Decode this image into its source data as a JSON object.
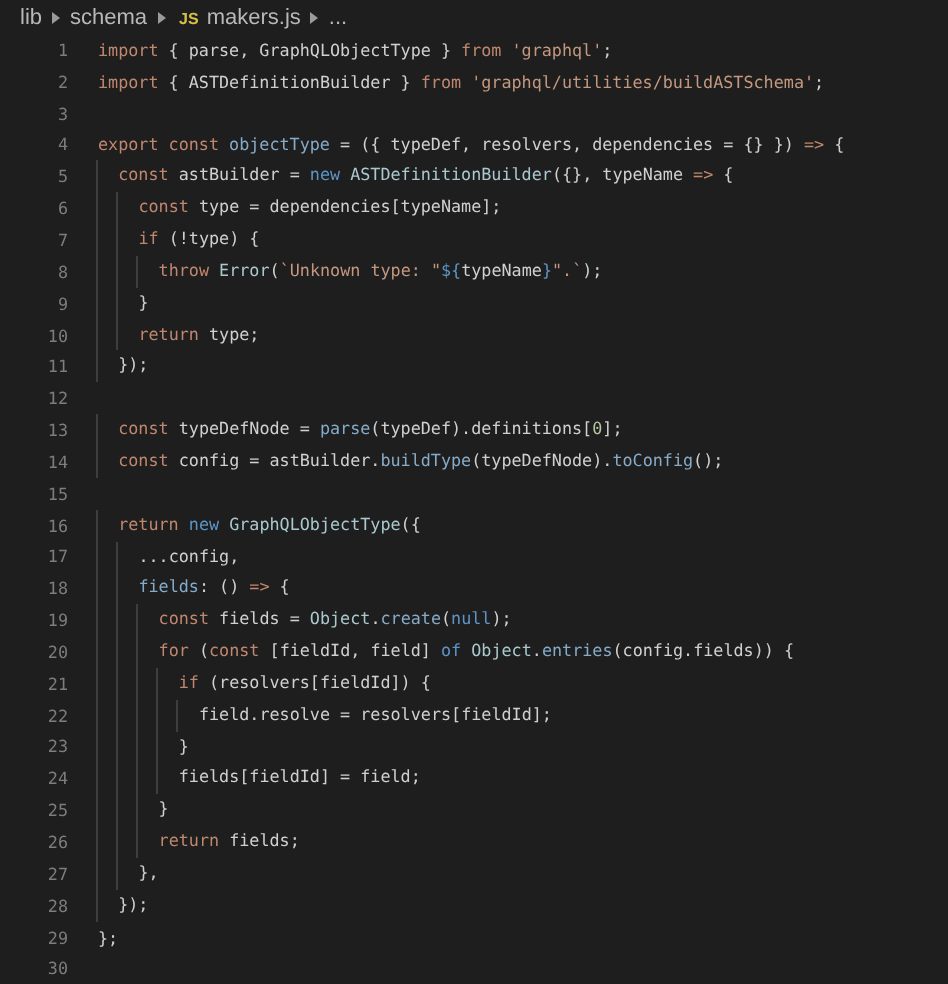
{
  "breadcrumb": [
    {
      "kind": "folder",
      "label": "lib"
    },
    {
      "kind": "folder",
      "label": "schema"
    },
    {
      "kind": "file",
      "badge": "JS",
      "label": "makers.js"
    },
    {
      "kind": "more",
      "label": "..."
    }
  ],
  "lines": [
    {
      "number": "1",
      "tokens": [
        {
          "kind": "kw",
          "text": "import"
        },
        {
          "kind": "plain",
          "text": " { parse, GraphQLObjectType } "
        },
        {
          "kind": "kw",
          "text": "from"
        },
        {
          "kind": "str",
          "text": " 'graphql'"
        },
        {
          "kind": "plain",
          "text": ";"
        }
      ]
    },
    {
      "number": "2",
      "tokens": [
        {
          "kind": "kw",
          "text": "import"
        },
        {
          "kind": "plain",
          "text": " { ASTDefinitionBuilder } "
        },
        {
          "kind": "kw",
          "text": "from"
        },
        {
          "kind": "str",
          "text": " 'graphql/utilities/buildASTSchema'"
        },
        {
          "kind": "plain",
          "text": ";"
        }
      ]
    },
    {
      "number": "3"
    },
    {
      "number": "4",
      "tokens": [
        {
          "kind": "kw",
          "text": "export const"
        },
        {
          "kind": "fn",
          "text": " objectType"
        },
        {
          "kind": "plain",
          "text": " = ({ typeDef, resolvers, dependencies = {} }) "
        },
        {
          "kind": "kw",
          "text": "=>"
        },
        {
          "kind": "plain",
          "text": " {"
        }
      ]
    },
    {
      "number": "5",
      "tokens": [
        {
          "kind": "kw",
          "text": "  const"
        },
        {
          "kind": "plain",
          "text": " astBuilder = "
        },
        {
          "kind": "blue",
          "text": "new"
        },
        {
          "kind": "cls",
          "text": " ASTDefinitionBuilder"
        },
        {
          "kind": "plain",
          "text": "({}, typeName "
        },
        {
          "kind": "kw",
          "text": "=>"
        },
        {
          "kind": "plain",
          "text": " {"
        }
      ]
    },
    {
      "number": "6",
      "tokens": [
        {
          "kind": "kw",
          "text": "    const"
        },
        {
          "kind": "plain",
          "text": " type = dependencies[typeName];"
        }
      ]
    },
    {
      "number": "7",
      "tokens": [
        {
          "kind": "kw",
          "text": "    if"
        },
        {
          "kind": "plain",
          "text": " (!type) {"
        }
      ]
    },
    {
      "number": "8",
      "tokens": [
        {
          "kind": "kw",
          "text": "      throw"
        },
        {
          "kind": "cls",
          "text": " Error"
        },
        {
          "kind": "plain",
          "text": "("
        },
        {
          "kind": "str",
          "text": "`Unknown type: \""
        },
        {
          "kind": "blue",
          "text": "${"
        },
        {
          "kind": "plain",
          "text": "typeName"
        },
        {
          "kind": "blue",
          "text": "}"
        },
        {
          "kind": "str",
          "text": "\".`"
        },
        {
          "kind": "plain",
          "text": ");"
        }
      ]
    },
    {
      "number": "9",
      "tokens": [
        {
          "kind": "plain",
          "text": "    }"
        }
      ]
    },
    {
      "number": "10",
      "tokens": [
        {
          "kind": "kw",
          "text": "    return"
        },
        {
          "kind": "plain",
          "text": " type;"
        }
      ]
    },
    {
      "number": "11",
      "tokens": [
        {
          "kind": "plain",
          "text": "  });"
        }
      ]
    },
    {
      "number": "12"
    },
    {
      "number": "13",
      "tokens": [
        {
          "kind": "kw",
          "text": "  const"
        },
        {
          "kind": "plain",
          "text": " typeDefNode = "
        },
        {
          "kind": "fn",
          "text": "parse"
        },
        {
          "kind": "plain",
          "text": "(typeDef).definitions["
        },
        {
          "kind": "num",
          "text": "0"
        },
        {
          "kind": "plain",
          "text": "];"
        }
      ]
    },
    {
      "number": "14",
      "tokens": [
        {
          "kind": "kw",
          "text": "  const"
        },
        {
          "kind": "plain",
          "text": " config = astBuilder."
        },
        {
          "kind": "fn",
          "text": "buildType"
        },
        {
          "kind": "plain",
          "text": "(typeDefNode)."
        },
        {
          "kind": "fn",
          "text": "toConfig"
        },
        {
          "kind": "plain",
          "text": "();"
        }
      ]
    },
    {
      "number": "15"
    },
    {
      "number": "16",
      "tokens": [
        {
          "kind": "kw",
          "text": "  return"
        },
        {
          "kind": "blue",
          "text": " new"
        },
        {
          "kind": "cls",
          "text": " GraphQLObjectType"
        },
        {
          "kind": "plain",
          "text": "({"
        }
      ]
    },
    {
      "number": "17",
      "tokens": [
        {
          "kind": "plain",
          "text": "    ...config,"
        }
      ]
    },
    {
      "number": "18",
      "tokens": [
        {
          "kind": "fn",
          "text": "    fields"
        },
        {
          "kind": "plain",
          "text": ": () "
        },
        {
          "kind": "kw",
          "text": "=>"
        },
        {
          "kind": "plain",
          "text": " {"
        }
      ]
    },
    {
      "number": "19",
      "tokens": [
        {
          "kind": "kw",
          "text": "      const"
        },
        {
          "kind": "plain",
          "text": " fields = "
        },
        {
          "kind": "cls",
          "text": "Object"
        },
        {
          "kind": "plain",
          "text": "."
        },
        {
          "kind": "fn",
          "text": "create"
        },
        {
          "kind": "plain",
          "text": "("
        },
        {
          "kind": "blue",
          "text": "null"
        },
        {
          "kind": "plain",
          "text": ");"
        }
      ]
    },
    {
      "number": "20",
      "tokens": [
        {
          "kind": "kw",
          "text": "      for"
        },
        {
          "kind": "plain",
          "text": " ("
        },
        {
          "kind": "kw",
          "text": "const"
        },
        {
          "kind": "plain",
          "text": " [fieldId, field] "
        },
        {
          "kind": "blue",
          "text": "of"
        },
        {
          "kind": "cls",
          "text": " Object"
        },
        {
          "kind": "plain",
          "text": "."
        },
        {
          "kind": "fn",
          "text": "entries"
        },
        {
          "kind": "plain",
          "text": "(config.fields)) {"
        }
      ]
    },
    {
      "number": "21",
      "tokens": [
        {
          "kind": "kw",
          "text": "        if"
        },
        {
          "kind": "plain",
          "text": " (resolvers[fieldId]) {"
        }
      ]
    },
    {
      "number": "22",
      "tokens": [
        {
          "kind": "plain",
          "text": "          field.resolve = resolvers[fieldId];"
        }
      ]
    },
    {
      "number": "23",
      "tokens": [
        {
          "kind": "plain",
          "text": "        }"
        }
      ]
    },
    {
      "number": "24",
      "tokens": [
        {
          "kind": "plain",
          "text": "        fields[fieldId] = field;"
        }
      ]
    },
    {
      "number": "25",
      "tokens": [
        {
          "kind": "plain",
          "text": "      }"
        }
      ]
    },
    {
      "number": "26",
      "tokens": [
        {
          "kind": "kw",
          "text": "      return"
        },
        {
          "kind": "plain",
          "text": " fields;"
        }
      ]
    },
    {
      "number": "27",
      "tokens": [
        {
          "kind": "plain",
          "text": "    },"
        }
      ]
    },
    {
      "number": "28",
      "tokens": [
        {
          "kind": "plain",
          "text": "  });"
        }
      ]
    },
    {
      "number": "29",
      "tokens": [
        {
          "kind": "plain",
          "text": "};"
        }
      ]
    },
    {
      "number": "30"
    }
  ]
}
